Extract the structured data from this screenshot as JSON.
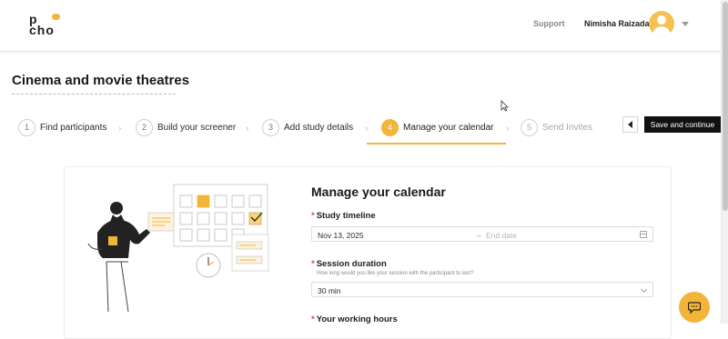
{
  "header": {
    "logo_line1": "p",
    "logo_line2": "cho",
    "support_label": "Support",
    "user_name": "Nimisha Raizada",
    "avatar_icon": "user-icon",
    "caret_icon": "chevron-down-icon"
  },
  "page": {
    "title": "Cinema and movie theatres"
  },
  "steps": [
    {
      "number": "1",
      "label": "Find participants",
      "state": "done"
    },
    {
      "number": "2",
      "label": "Build your screener",
      "state": "done"
    },
    {
      "number": "3",
      "label": "Add study details",
      "state": "done"
    },
    {
      "number": "4",
      "label": "Manage your calendar",
      "state": "active"
    },
    {
      "number": "5",
      "label": "Send Invites",
      "state": "disabled"
    }
  ],
  "actions": {
    "back_icon": "chevron-left-icon",
    "save_label": "Save and continue"
  },
  "form": {
    "title": "Manage your calendar",
    "study_timeline": {
      "label": "Study timeline",
      "start_value": "Nov 13, 2025",
      "separator": "→",
      "end_placeholder": "End date",
      "icon": "calendar-icon"
    },
    "session_duration": {
      "label": "Session duration",
      "help": "How long would you like your session with the participant to last?",
      "value": "30 min",
      "icon": "chevron-down-icon"
    },
    "working_hours": {
      "label": "Your working hours"
    }
  },
  "colors": {
    "accent": "#f2b53a",
    "primary_button": "#111111",
    "required": "#e0463a"
  },
  "chat": {
    "icon": "chat-bubble-icon"
  }
}
